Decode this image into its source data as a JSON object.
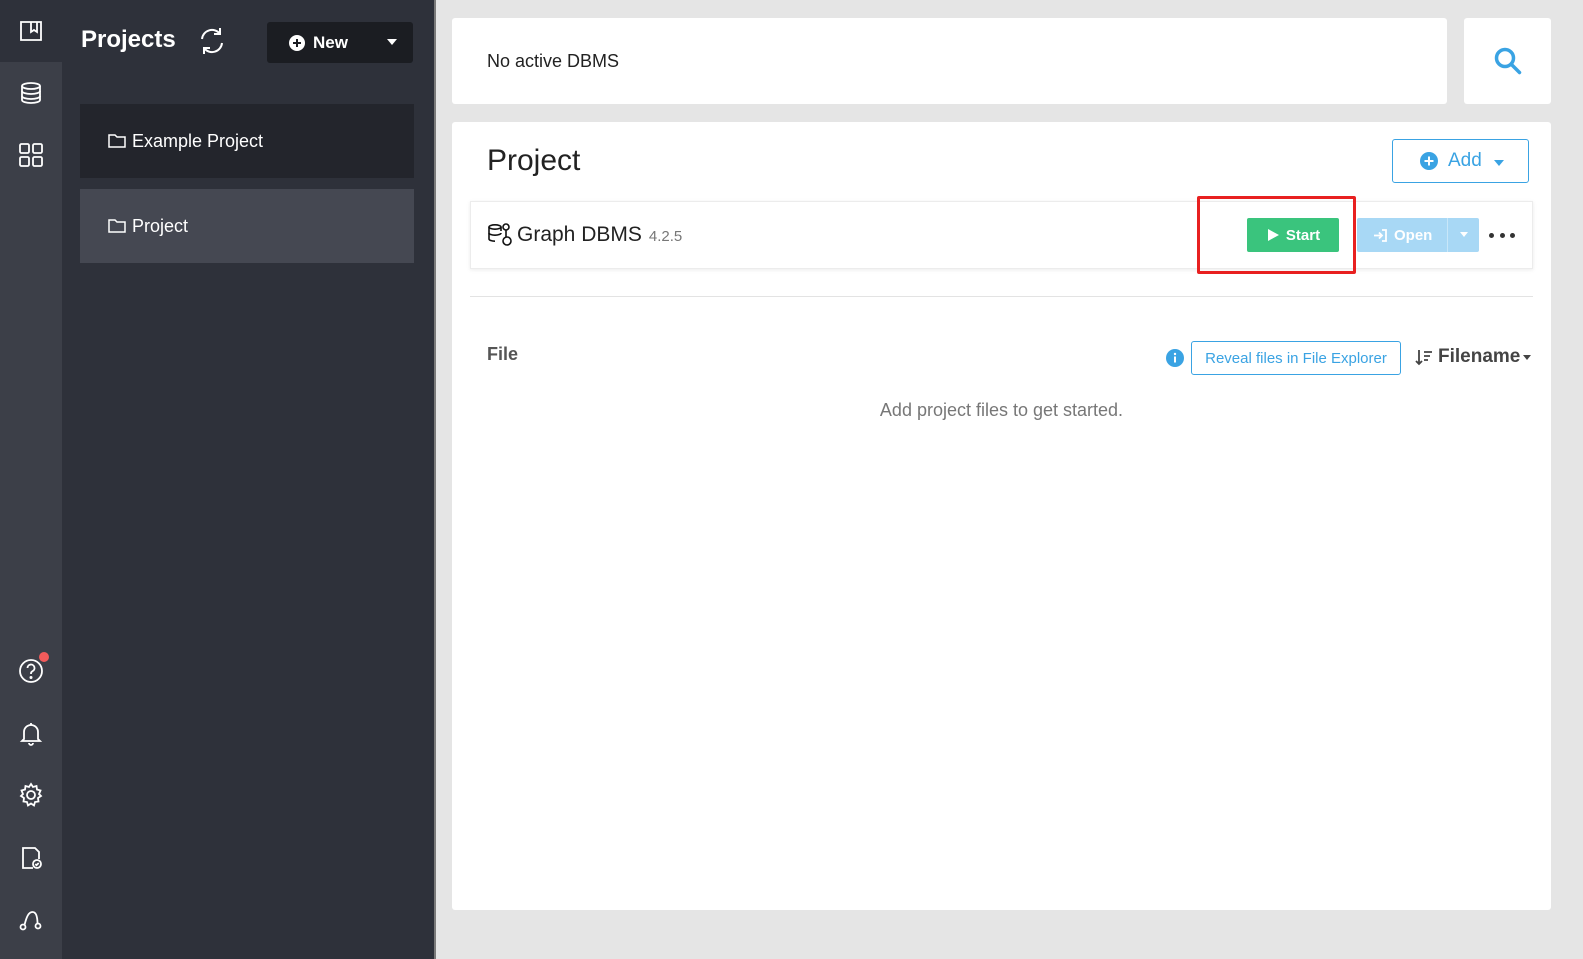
{
  "sidebar": {
    "title": "Projects",
    "new_label": "New",
    "projects": [
      {
        "label": "Example Project"
      },
      {
        "label": "Project"
      }
    ]
  },
  "header": {
    "status_text": "No active DBMS"
  },
  "main": {
    "title": "Project",
    "add_label": "Add",
    "dbms": {
      "name": "Graph DBMS",
      "version": "4.2.5",
      "start_label": "Start",
      "open_label": "Open"
    },
    "files": {
      "label": "File",
      "reveal_label": "Reveal files in File Explorer",
      "sort_label": "Filename",
      "empty_message": "Add project files to get started."
    }
  },
  "colors": {
    "accent": "#3aa3e3",
    "start_green": "#3ac47d",
    "highlight_red": "#e82020"
  }
}
